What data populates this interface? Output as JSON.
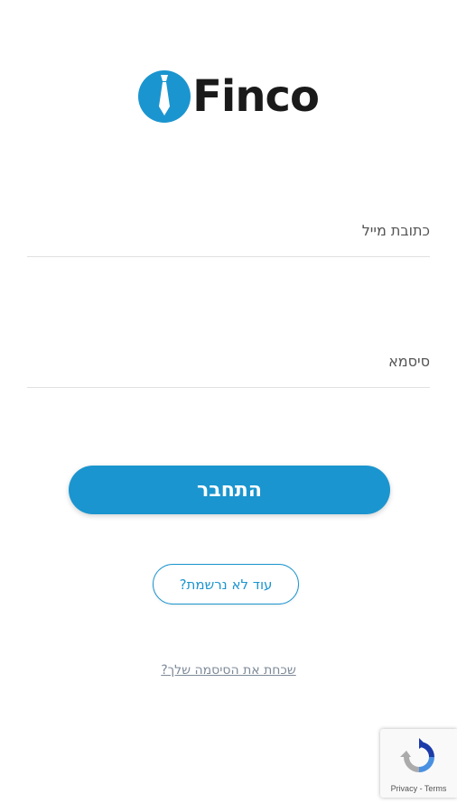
{
  "brand": {
    "name": "Finco",
    "accent_color": "#1b95cf",
    "logo_icon": "tie-icon"
  },
  "form": {
    "email": {
      "label": "כתובת מייל",
      "value": ""
    },
    "password": {
      "label": "סיסמא",
      "value": ""
    },
    "login_label": "התחבר",
    "register_label": "עוד לא נרשמת?",
    "forgot_label": "שכחת את הסיסמה שלך?"
  },
  "recaptcha": {
    "icon": "recaptcha-icon",
    "privacy_label": "Privacy",
    "separator": " - ",
    "terms_label": "Terms"
  }
}
